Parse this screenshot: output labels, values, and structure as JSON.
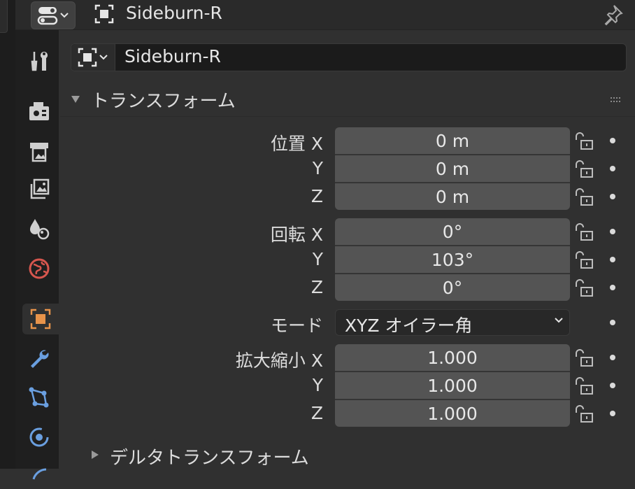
{
  "header": {
    "title": "Sideburn-R"
  },
  "object_name": {
    "value": "Sideburn-R"
  },
  "transform_panel": {
    "title": "トランスフォーム",
    "location": {
      "label": "位置",
      "x_axis": "X",
      "y_axis": "Y",
      "z_axis": "Z",
      "x": "0 m",
      "y": "0 m",
      "z": "0 m"
    },
    "rotation": {
      "label": "回転",
      "x_axis": "X",
      "y_axis": "Y",
      "z_axis": "Z",
      "x": "0°",
      "y": "103°",
      "z": "0°"
    },
    "mode": {
      "label": "モード",
      "value": "XYZ オイラー角"
    },
    "scale": {
      "label": "拡大縮小",
      "x_axis": "X",
      "y_axis": "Y",
      "z_axis": "Z",
      "x": "1.000",
      "y": "1.000",
      "z": "1.000"
    }
  },
  "delta_panel": {
    "title": "デルタトランスフォーム"
  },
  "colors": {
    "active_tab_icon": "#e8934a",
    "modifier_icon": "#6a9fe0",
    "world_icon": "#d6564e",
    "field_bg": "#545454",
    "panel_bg": "#303030"
  },
  "icons": [
    "properties-editor-icon",
    "object-icon",
    "pin-icon",
    "tool-icon",
    "render-icon",
    "output-icon",
    "view-layer-icon",
    "scene-icon",
    "world-icon",
    "object-tab-icon",
    "modifier-icon",
    "particles-icon",
    "physics-icon",
    "lock-icon",
    "keyframe-dot-icon"
  ]
}
